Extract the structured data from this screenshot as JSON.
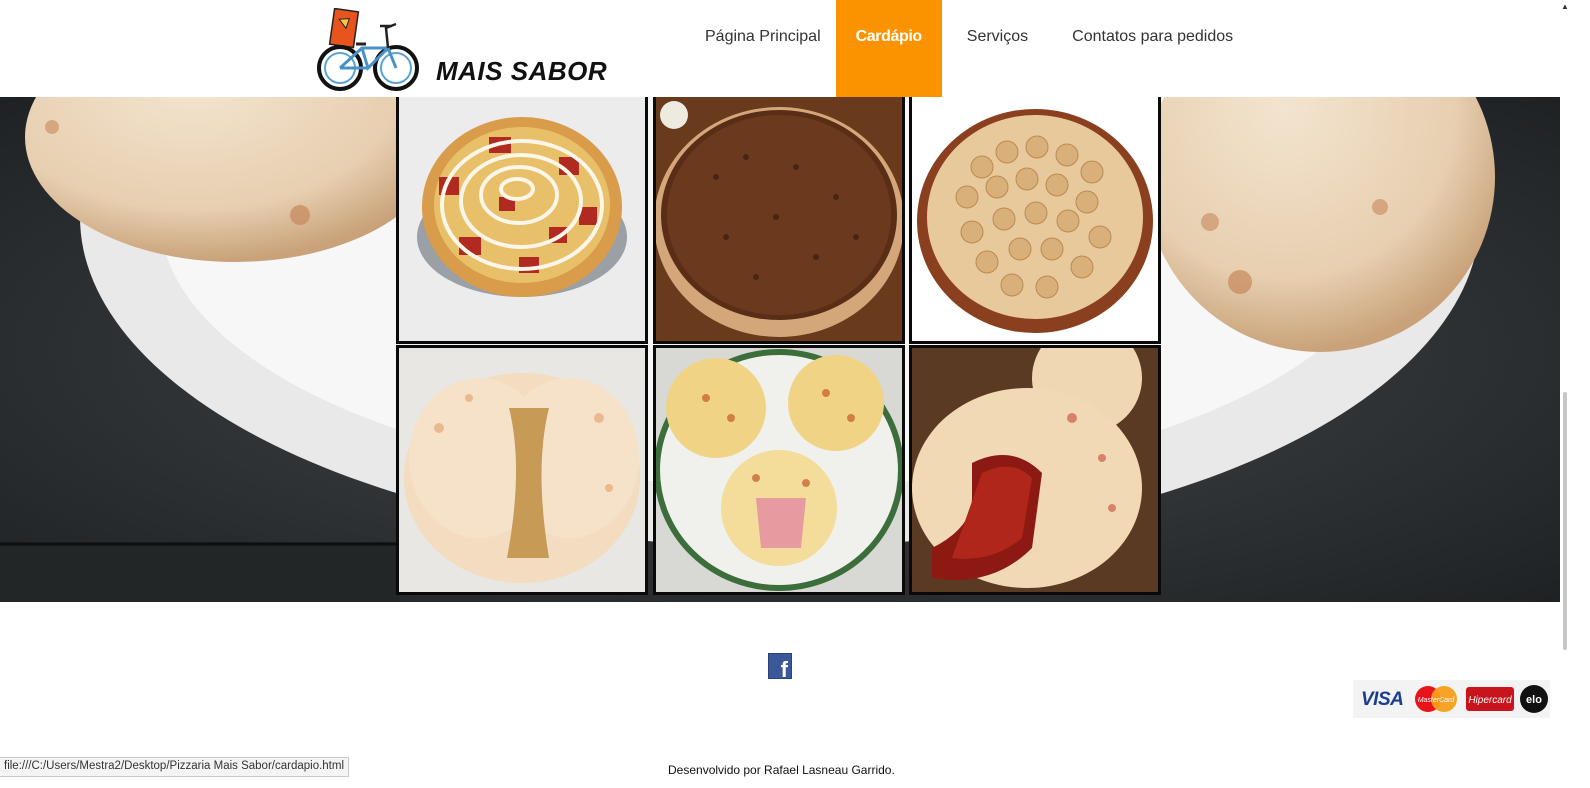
{
  "brand": {
    "name": "MAIS SABOR",
    "logo_icon": "bicycle-pizza-delivery-icon"
  },
  "nav": {
    "items": [
      {
        "label": "Página Principal",
        "active": false
      },
      {
        "label": "Cardápio",
        "active": true
      },
      {
        "label": "Serviços",
        "active": false
      },
      {
        "label": "Contatos para pedidos",
        "active": false
      }
    ],
    "active_color": "#fb9300"
  },
  "gallery": {
    "items": [
      "pizza-calabresa",
      "pizza-chocolate-granulado",
      "pizza-banana",
      "pao-de-queijo-recheado-frango",
      "pao-de-queijo-presunto",
      "pao-de-queijo-goiabada"
    ]
  },
  "footer": {
    "social_icon": "facebook-icon",
    "payment_cards": [
      "VISA",
      "MasterCard",
      "Hipercard",
      "elo"
    ],
    "credit": "Desenvolvido por Rafael Lasneau Garrido."
  },
  "status": {
    "url": "file:///C:/Users/Mestra2/Desktop/Pizzaria Mais Sabor/cardapio.html"
  }
}
